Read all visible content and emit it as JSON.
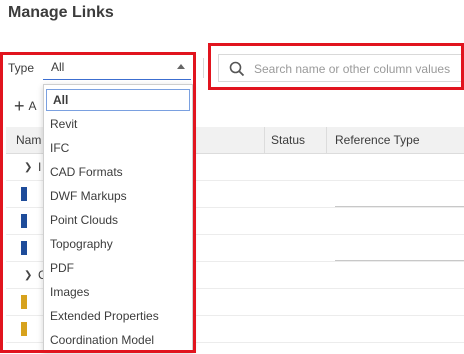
{
  "window": {
    "title": "Manage Links"
  },
  "filter": {
    "type_label": "Type",
    "selected": "All",
    "options": [
      "All",
      "Revit",
      "IFC",
      "CAD Formats",
      "DWF Markups",
      "Point Clouds",
      "Topography",
      "PDF",
      "Images",
      "Extended Properties",
      "Coordination Model"
    ]
  },
  "search": {
    "placeholder": "Search name or other column values"
  },
  "toolbar": {
    "add_label": "A"
  },
  "table": {
    "columns": {
      "name": "Nam",
      "status": "Status",
      "reference_type": "Reference Type"
    },
    "groups": [
      {
        "label": "I"
      },
      {
        "label": "C"
      }
    ]
  },
  "colors": {
    "highlight": "#e1141e",
    "focus": "#3c6fd1",
    "revit_icon": "#1e4c9a"
  }
}
